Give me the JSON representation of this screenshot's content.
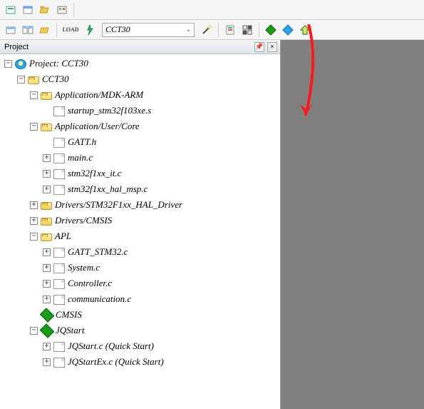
{
  "toolbar1": {
    "buttons": [
      "icon-a",
      "icon-b",
      "icon-c",
      "icon-d",
      "icon-e",
      "icon-f"
    ]
  },
  "toolbar2": {
    "load_label": "LOAD",
    "combo_value": "CCT30",
    "combo_caret": "⌄"
  },
  "panel": {
    "title": "Project",
    "pin": "📌",
    "close": "×"
  },
  "tree": {
    "root": {
      "label": "Project: CCT30",
      "expanded": true,
      "icon": "proj-icon",
      "children": [
        {
          "label": "CCT30",
          "expanded": true,
          "icon": "folder-open",
          "children": [
            {
              "label": "Application/MDK-ARM",
              "expanded": true,
              "icon": "folder-open",
              "children": [
                {
                  "label": "startup_stm32f103xe.s",
                  "icon": "file",
                  "leaf": true
                }
              ]
            },
            {
              "label": "Application/User/Core",
              "expanded": true,
              "icon": "folder-open",
              "children": [
                {
                  "label": "GATT.h",
                  "icon": "file",
                  "leaf": true
                },
                {
                  "label": "main.c",
                  "icon": "file",
                  "leaf": true,
                  "expandable": true
                },
                {
                  "label": "stm32f1xx_it.c",
                  "icon": "file",
                  "leaf": true,
                  "expandable": true
                },
                {
                  "label": "stm32f1xx_hal_msp.c",
                  "icon": "file",
                  "leaf": true,
                  "expandable": true
                }
              ]
            },
            {
              "label": "Drivers/STM32F1xx_HAL_Driver",
              "expanded": false,
              "icon": "folder-closed",
              "expandable": true
            },
            {
              "label": "Drivers/CMSIS",
              "expanded": false,
              "icon": "folder-closed",
              "expandable": true
            },
            {
              "label": "APL",
              "expanded": true,
              "icon": "folder-open",
              "children": [
                {
                  "label": "GATT_STM32.c",
                  "icon": "file",
                  "leaf": true,
                  "expandable": true
                },
                {
                  "label": "System.c",
                  "icon": "file",
                  "leaf": true,
                  "expandable": true
                },
                {
                  "label": "Controller.c",
                  "icon": "file",
                  "leaf": true,
                  "expandable": true
                },
                {
                  "label": "communication.c",
                  "icon": "file",
                  "leaf": true,
                  "expandable": true
                }
              ]
            },
            {
              "label": "CMSIS",
              "icon": "diamond-green",
              "leaf": true
            },
            {
              "label": "JQStart",
              "expanded": true,
              "icon": "diamond-green",
              "children": [
                {
                  "label": "JQStart.c (Quick Start)",
                  "icon": "file",
                  "leaf": true,
                  "expandable": true
                },
                {
                  "label": "JQStartEx.c (Quick Start)",
                  "icon": "file",
                  "leaf": true,
                  "expandable": true
                }
              ]
            }
          ]
        }
      ]
    }
  }
}
